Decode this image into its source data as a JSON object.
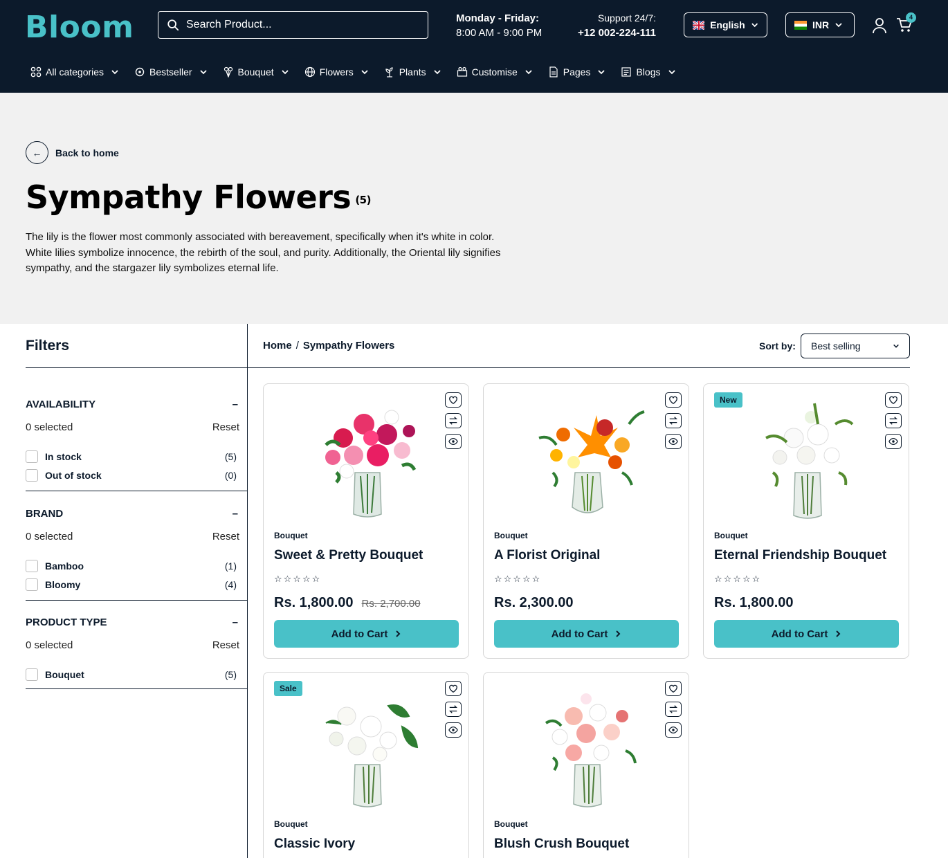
{
  "header": {
    "logo": "Bloom",
    "search_placeholder": "Search Product...",
    "hours_days": "Monday - Friday:",
    "hours_time": "8:00 AM - 9:00 PM",
    "support_label": "Support 24/7:",
    "support_phone": "+12 002-224-111",
    "language": "English",
    "currency": "INR",
    "cart_count": "4"
  },
  "nav": [
    {
      "label": "All categories",
      "icon": "grid-icon"
    },
    {
      "label": "Bestseller",
      "icon": "target-icon"
    },
    {
      "label": "Bouquet",
      "icon": "bouquet-icon"
    },
    {
      "label": "Flowers",
      "icon": "globe-flower-icon"
    },
    {
      "label": "Plants",
      "icon": "plant-icon"
    },
    {
      "label": "Customise",
      "icon": "customise-icon"
    },
    {
      "label": "Pages",
      "icon": "page-icon"
    },
    {
      "label": "Blogs",
      "icon": "blog-icon"
    }
  ],
  "hero": {
    "back_label": "Back to home",
    "title": "Sympathy Flowers",
    "count": "(5)",
    "description_1": "The lily is the flower most commonly associated with bereavement, specifically when it's white in color.",
    "description_2": "White lilies symbolize innocence, the rebirth of the soul, and purity. Additionally, the Oriental lily signifies",
    "description_3": "sympathy, and the stargazer lily symbolizes eternal life."
  },
  "filters": {
    "title": "Filters",
    "groups": [
      {
        "title": "AVAILABILITY",
        "selected": "0 selected",
        "reset": "Reset",
        "toggle": "–",
        "options": [
          {
            "label": "In stock",
            "count": "(5)"
          },
          {
            "label": "Out of stock",
            "count": "(0)"
          }
        ]
      },
      {
        "title": "BRAND",
        "selected": "0 selected",
        "reset": "Reset",
        "toggle": "–",
        "options": [
          {
            "label": "Bamboo",
            "count": "(1)"
          },
          {
            "label": "Bloomy",
            "count": "(4)"
          }
        ]
      },
      {
        "title": "PRODUCT TYPE",
        "selected": "0 selected",
        "reset": "Reset",
        "toggle": "–",
        "options": [
          {
            "label": "Bouquet",
            "count": "(5)"
          }
        ]
      }
    ]
  },
  "listing": {
    "breadcrumb_home": "Home",
    "breadcrumb_sep": "/",
    "breadcrumb_current": "Sympathy Flowers",
    "sort_label": "Sort by:",
    "sort_value": "Best selling"
  },
  "products": [
    {
      "category": "Bouquet",
      "name": "Sweet & Pretty Bouquet",
      "price": "Rs. 1,800.00",
      "old_price": "Rs. 2,700.00",
      "badge": "",
      "stars": "☆☆☆☆☆",
      "button": "Add to Cart"
    },
    {
      "category": "Bouquet",
      "name": "A Florist Original",
      "price": "Rs. 2,300.00",
      "old_price": "",
      "badge": "",
      "stars": "☆☆☆☆☆",
      "button": "Add to Cart"
    },
    {
      "category": "Bouquet",
      "name": "Eternal Friendship Bouquet",
      "price": "Rs. 1,800.00",
      "old_price": "",
      "badge": "New",
      "stars": "☆☆☆☆☆",
      "button": "Add to Cart"
    },
    {
      "category": "Bouquet",
      "name": "Classic Ivory",
      "price": "",
      "old_price": "",
      "badge": "Sale",
      "stars": "",
      "button": ""
    },
    {
      "category": "Bouquet",
      "name": "Blush Crush Bouquet",
      "price": "",
      "old_price": "",
      "badge": "",
      "stars": "",
      "button": ""
    }
  ],
  "colors": {
    "header_bg": "#0c1a2b",
    "accent": "#49c1c8",
    "hero_bg": "#f1f1f1"
  }
}
